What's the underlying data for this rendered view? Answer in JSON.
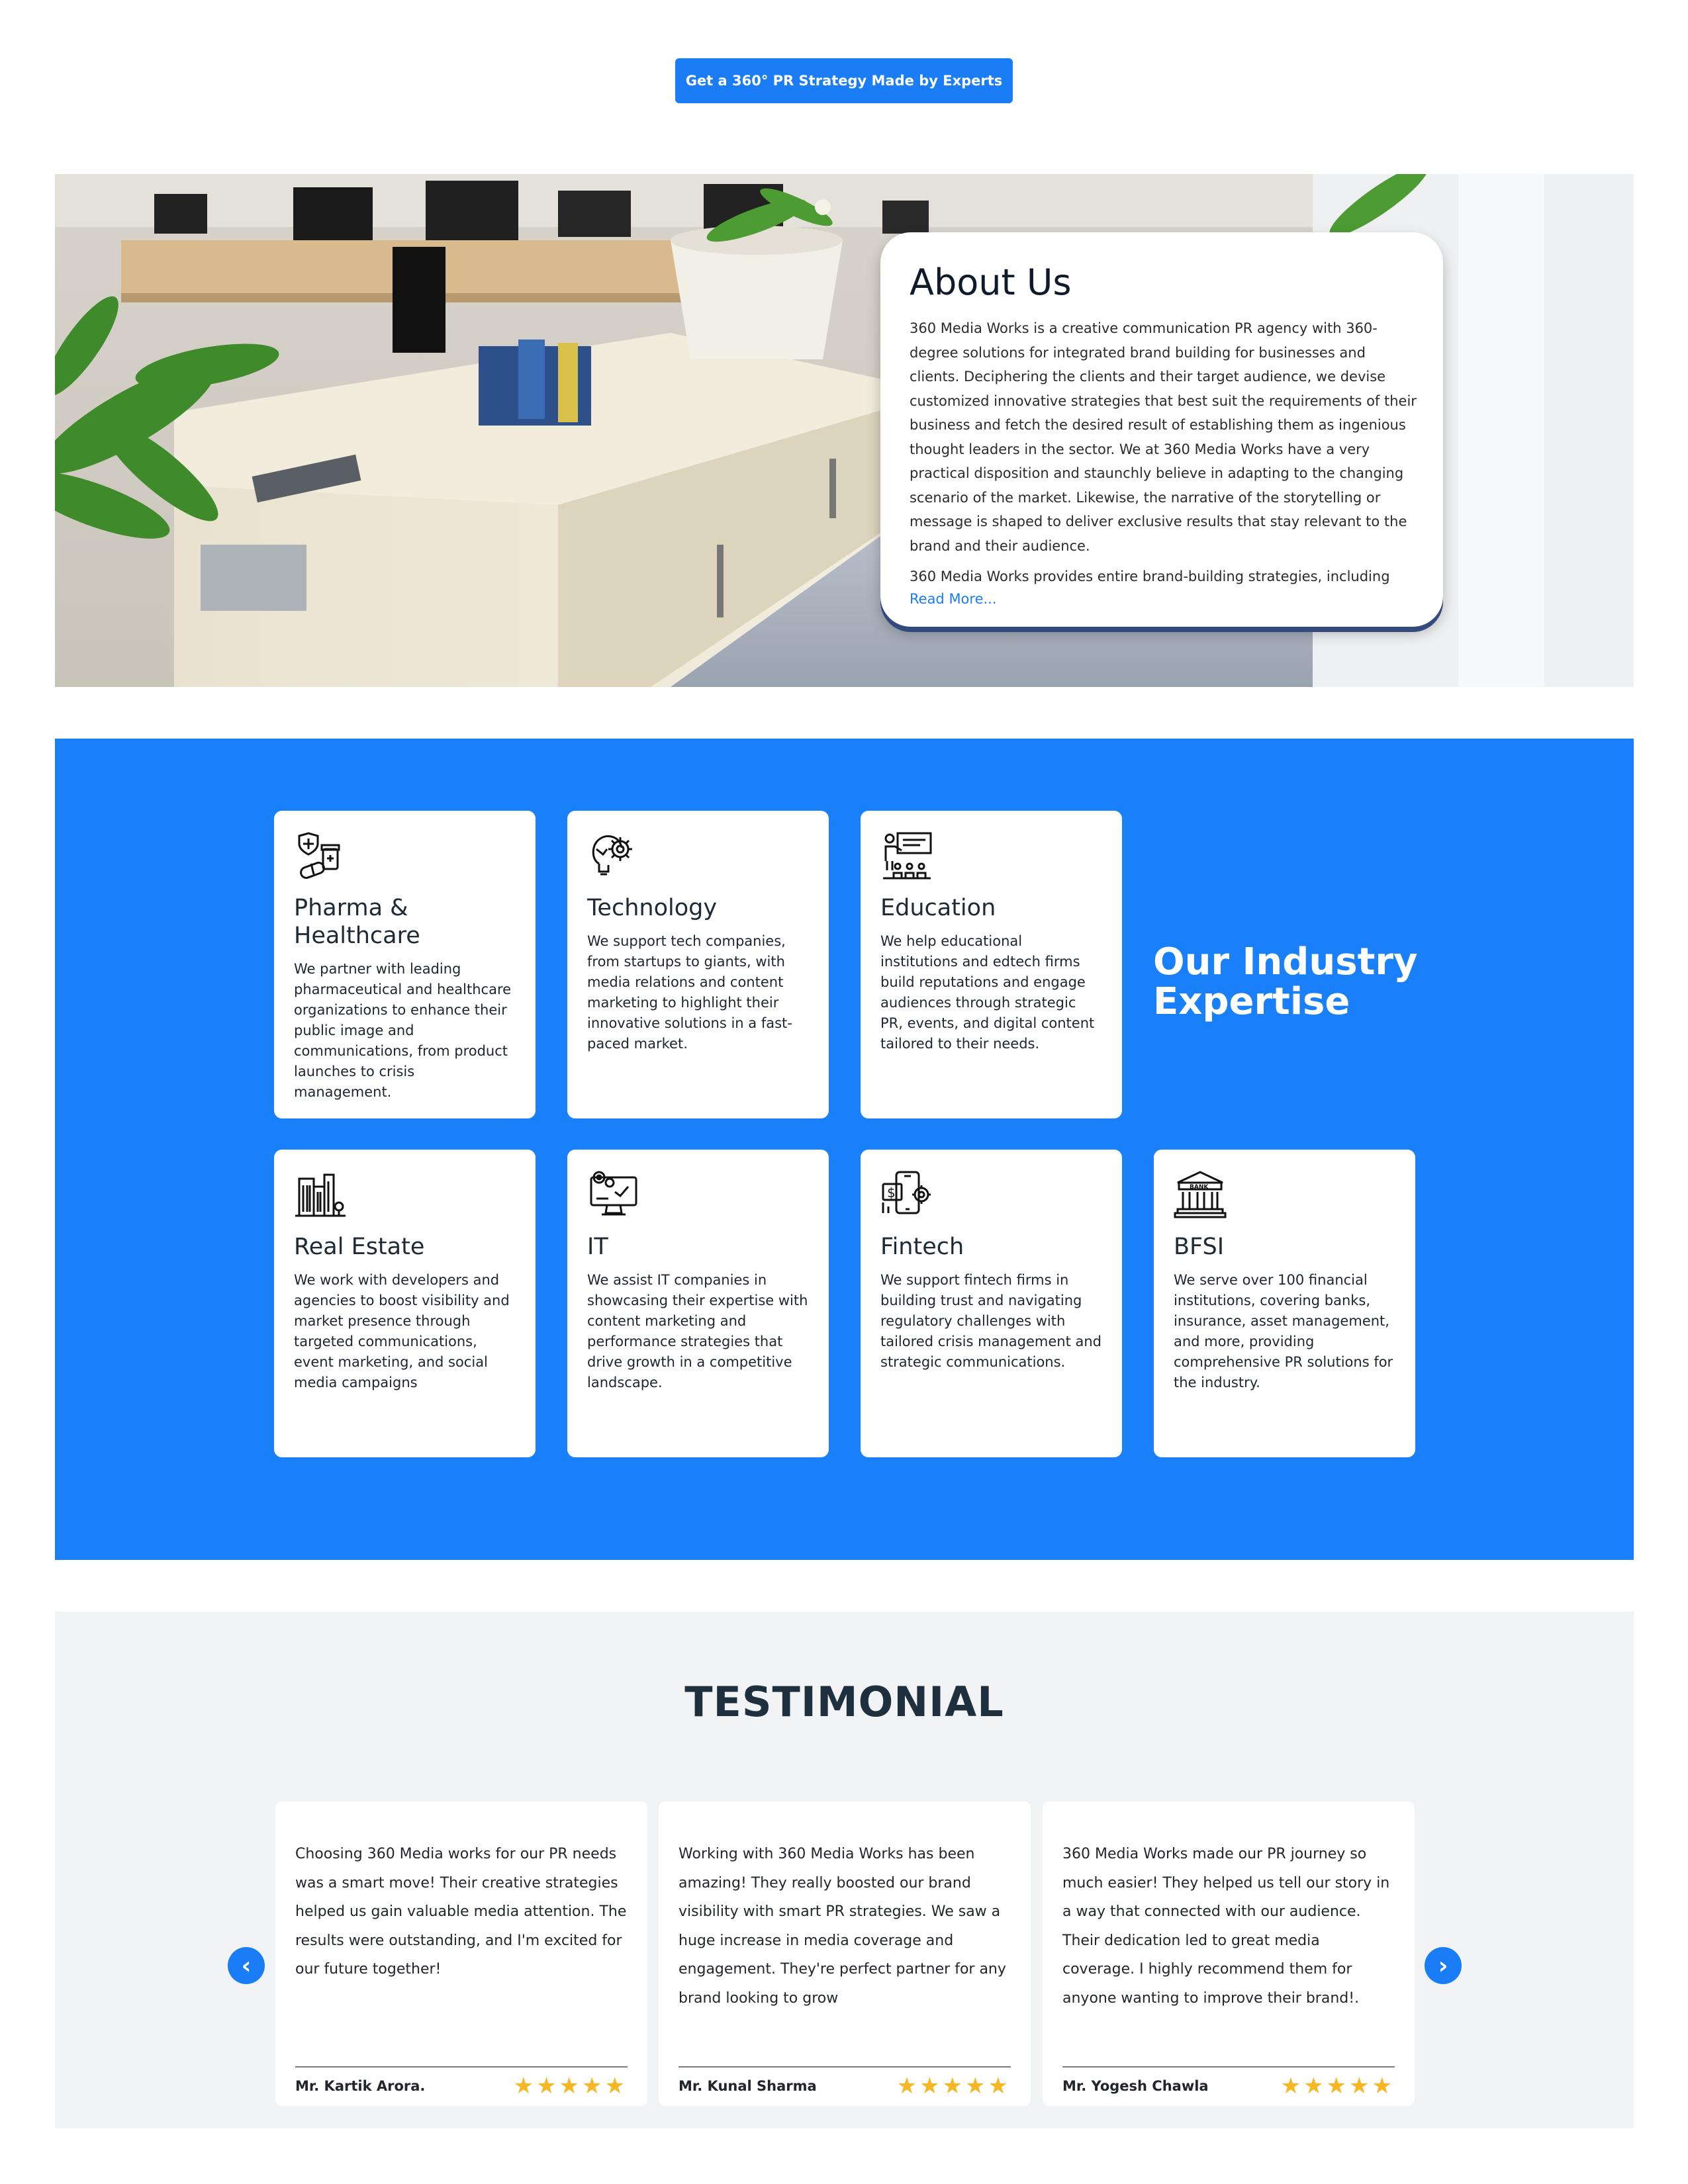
{
  "cta": {
    "label": "Get a 360° PR Strategy Made by Experts"
  },
  "about": {
    "title": "About Us",
    "paragraph1": "360 Media Works is a creative communication PR agency with 360-degree solutions for integrated brand building for businesses and clients. Deciphering the clients and their target audience, we devise customized innovative strategies that best suit the requirements of their business and fetch the desired result of establishing them as ingenious thought leaders in the sector. We at 360 Media Works have a very practical disposition and staunchly believe in adapting to the changing scenario of the market. Likewise, the narrative of the storytelling or message is shaped to deliver exclusive results that stay relevant to the brand and their audience.",
    "paragraph2": "360 Media Works provides entire brand-building strategies, including",
    "read_more": "Read More..."
  },
  "industry": {
    "heading": "Our Industry Expertise",
    "cards": [
      {
        "icon": "pharma-icon",
        "title": "Pharma & Healthcare",
        "desc": "We partner with leading pharmaceutical and healthcare organizations to enhance their public image and communications, from product launches to crisis management."
      },
      {
        "icon": "technology-icon",
        "title": "Technology",
        "desc": "We support tech companies, from startups to giants, with media relations and content marketing to highlight their innovative solutions in a fast-paced market."
      },
      {
        "icon": "education-icon",
        "title": "Education",
        "desc": "We help educational institutions and edtech firms build reputations and engage audiences through strategic PR, events, and digital content tailored to their needs."
      },
      {
        "icon": "real-estate-icon",
        "title": "Real Estate",
        "desc": "We work with developers and agencies to boost visibility and market presence through targeted communications, event marketing, and social media campaigns"
      },
      {
        "icon": "it-icon",
        "title": "IT",
        "desc": "We assist IT companies in showcasing their expertise with content marketing and performance strategies that drive growth in a competitive landscape."
      },
      {
        "icon": "fintech-icon",
        "title": "Fintech",
        "desc": "We support fintech firms in building trust and navigating regulatory challenges with tailored crisis management and strategic communications."
      },
      {
        "icon": "bank-icon",
        "title": "BFSI",
        "desc": "We serve over 100 financial institutions, covering banks, insurance, asset management, and more, providing comprehensive PR solutions for the industry.",
        "icon_text": "BANK"
      }
    ]
  },
  "testimonials": {
    "title": "TESTIMONIAL",
    "prev": "‹",
    "next": "›",
    "items": [
      {
        "text": "Choosing 360 Media works for our PR needs was a smart move! Their creative strategies helped us gain valuable media attention. The results were outstanding, and I'm excited for our future together!",
        "name": "Mr. Kartik Arora.",
        "stars": "★★★★★",
        "rating": 5
      },
      {
        "text": "Working with 360 Media Works has been amazing! They really boosted our brand visibility with smart PR strategies. We saw a huge increase in media coverage and engagement. They're perfect partner for any brand looking to grow",
        "name": "Mr. Kunal Sharma",
        "stars": "★★★★★",
        "rating": 5
      },
      {
        "text": "360 Media Works made our PR journey so much easier! They helped us tell our story in a way that connected with our audience. Their dedication led to great media coverage. I highly recommend them for anyone wanting to improve their brand!.",
        "name": "Mr. Yogesh Chawla",
        "stars": "★★★★★",
        "rating": 5
      }
    ]
  },
  "colors": {
    "accent": "#1a7df5",
    "industry_bg": "#1a80fa",
    "star": "#f7b623",
    "testimonial_bg": "#f2f3f5"
  }
}
